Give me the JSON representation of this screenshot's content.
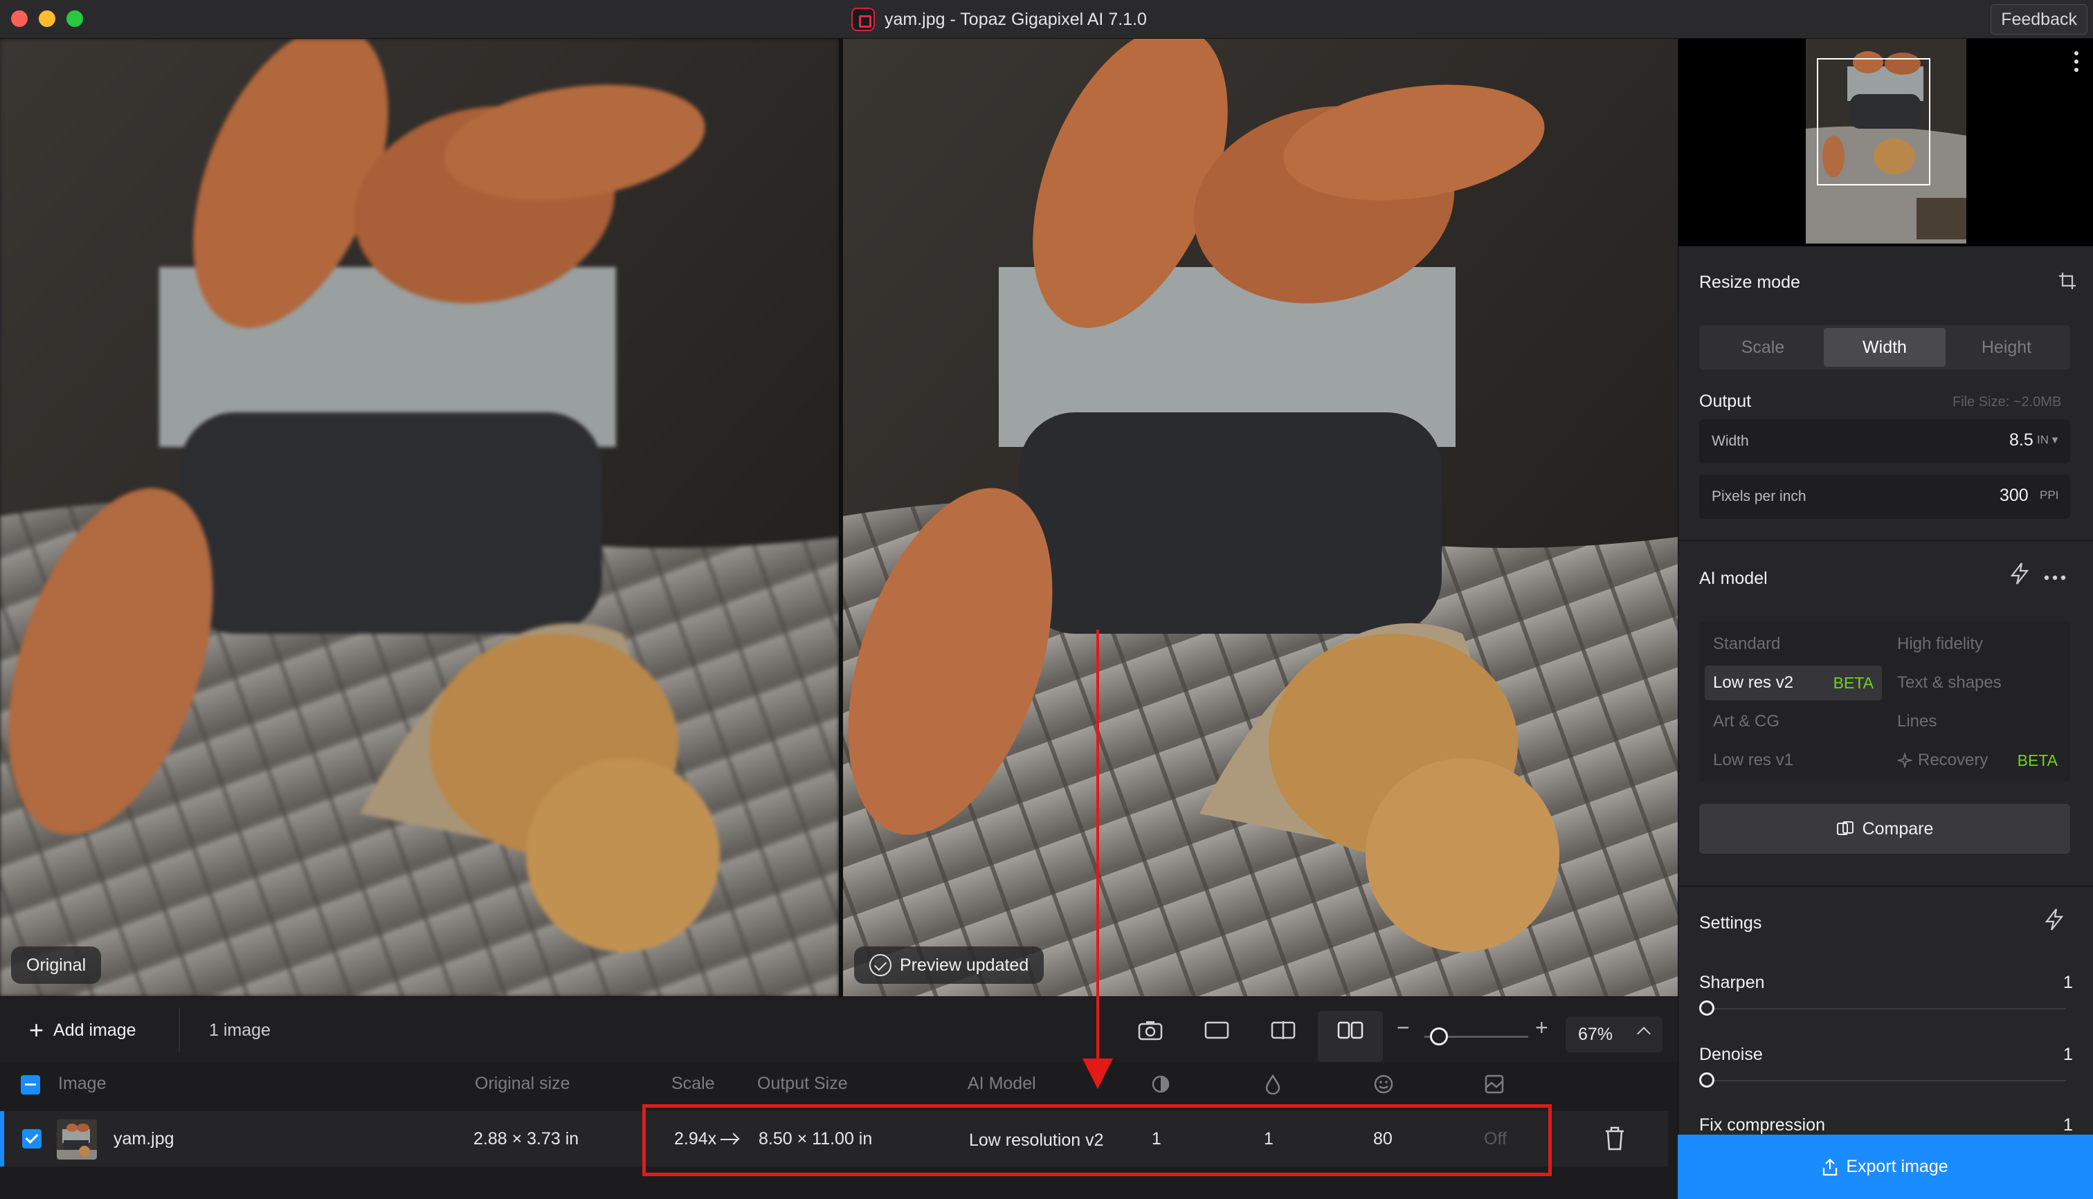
{
  "window": {
    "title": "yam.jpg - Topaz Gigapixel AI  7.1.0",
    "feedback_label": "Feedback"
  },
  "preview": {
    "left_badge": "Original",
    "right_badge": "Preview updated"
  },
  "toolbar": {
    "add_image_label": "Add image",
    "image_count": "1 image",
    "zoom_value": "67%",
    "zoom_level": 0.14
  },
  "table": {
    "headers": {
      "image": "Image",
      "original_size": "Original size",
      "scale": "Scale",
      "output_size": "Output Size",
      "ai_model": "AI Model"
    },
    "rows": [
      {
        "name": "yam.jpg",
        "original_size": "2.88 × 3.73 in",
        "scale": "2.94x",
        "output_size": "8.50 × 11.00 in",
        "ai_model": "Low resolution v2",
        "sharpen": "1",
        "denoise": "1",
        "face": "80",
        "fix": "Off"
      }
    ]
  },
  "sidebar": {
    "resize_mode": {
      "title": "Resize mode",
      "tabs": [
        "Scale",
        "Width",
        "Height"
      ],
      "active_tab": "Width"
    },
    "output": {
      "title": "Output",
      "file_size": "File Size: ~2.0MB",
      "width_label": "Width",
      "width_value": "8.5",
      "width_unit": "IN ▾",
      "ppi_label": "Pixels per inch",
      "ppi_value": "300",
      "ppi_unit": "PPI"
    },
    "ai_model": {
      "title": "AI model",
      "models": {
        "standard": "Standard",
        "high_fidelity": "High fidelity",
        "low_res_v2": "Low res v2",
        "low_res_v2_badge": "BETA",
        "text_shapes": "Text & shapes",
        "art_cg": "Art & CG",
        "lines": "Lines",
        "low_res_v1": "Low res v1",
        "recovery": "Recovery",
        "recovery_badge": "BETA"
      },
      "compare_label": "Compare"
    },
    "settings": {
      "title": "Settings",
      "sharpen_label": "Sharpen",
      "sharpen_value": "1",
      "denoise_label": "Denoise",
      "denoise_value": "1",
      "fix_label": "Fix compression",
      "fix_value": "1"
    },
    "export_label": "Export image"
  },
  "colors": {
    "accent": "#1a8cff",
    "beta": "#6fd31f",
    "annotation": "#e21a1a"
  }
}
